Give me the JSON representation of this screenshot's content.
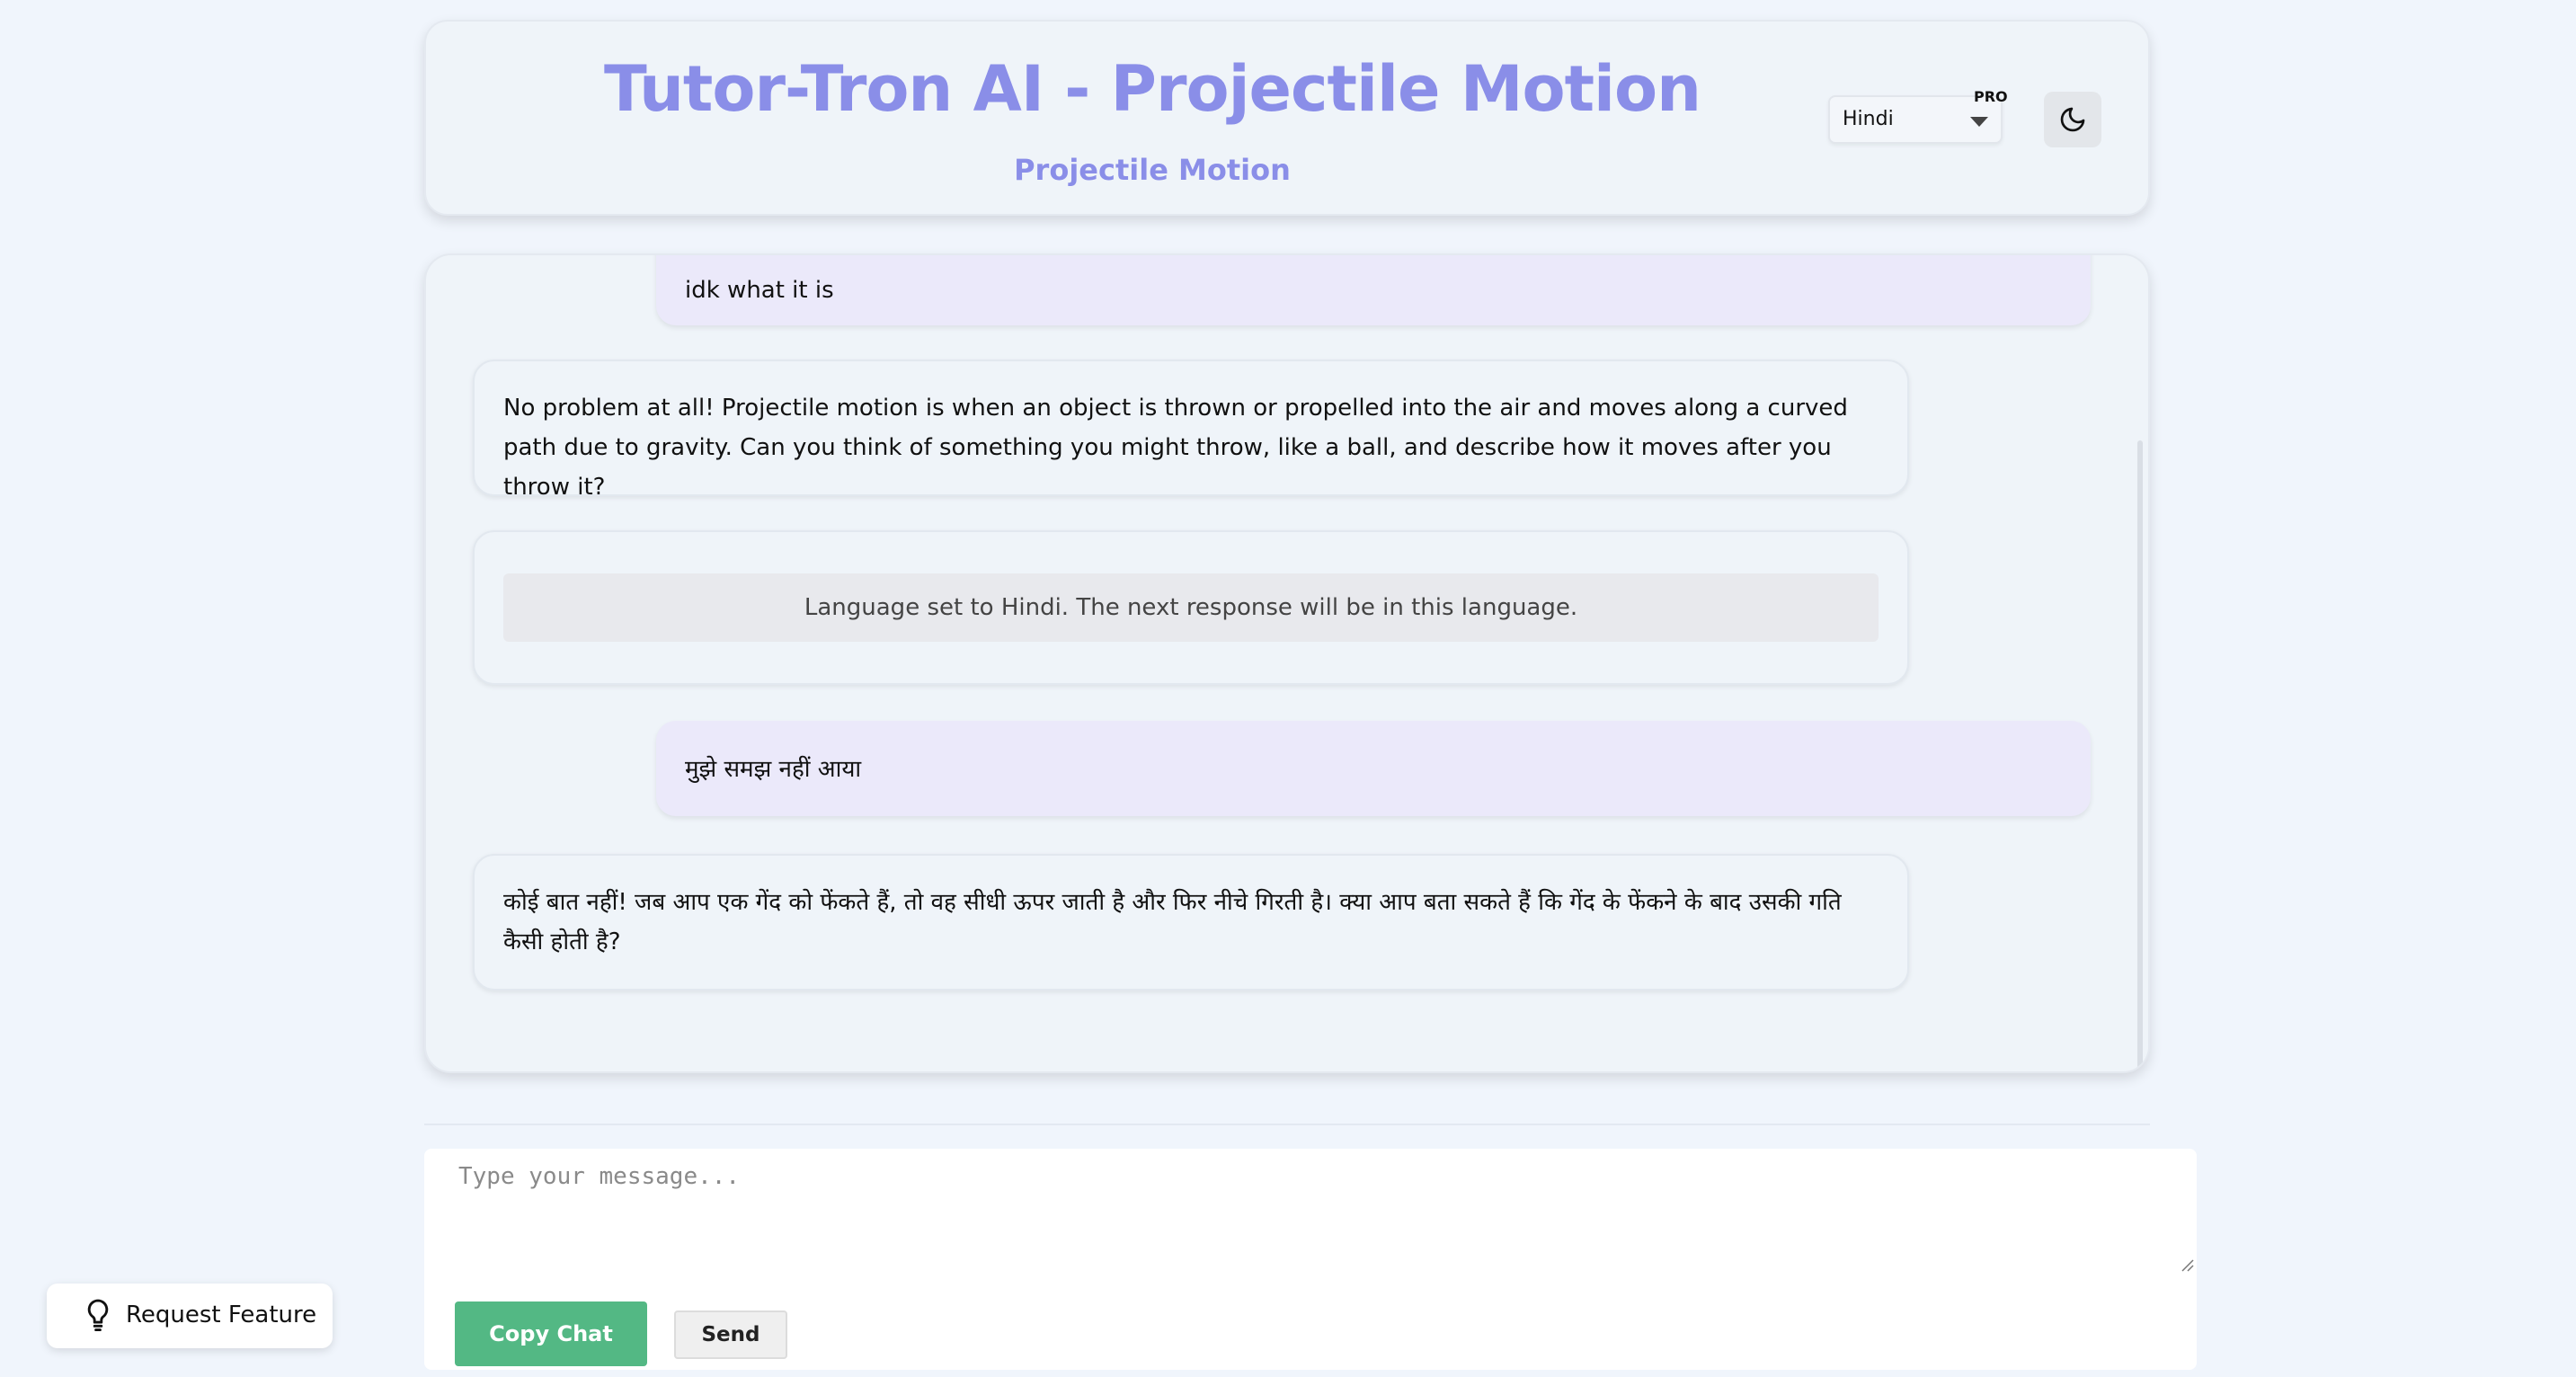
{
  "header": {
    "title": "Tutor-Tron AI - Projectile Motion",
    "subtitle": "Projectile Motion",
    "language_selected": "Hindi",
    "pro_badge": "PRO",
    "theme_toggle_icon": "moon-icon"
  },
  "messages": [
    {
      "role": "user",
      "text": "idk what it is"
    },
    {
      "role": "assistant",
      "text": "No problem at all! Projectile motion is when an object is thrown or propelled into the air and moves along a curved path due to gravity. Can you think of something you might throw, like a ball, and describe how it moves after you throw it?"
    },
    {
      "role": "system",
      "text": "Language set to Hindi. The next response will be in this language."
    },
    {
      "role": "user",
      "text": "मुझे समझ नहीं आया"
    },
    {
      "role": "assistant",
      "text": "कोई बात नहीं! जब आप एक गेंद को फेंकते हैं, तो वह सीधी ऊपर जाती है और फिर नीचे गिरती है। क्या आप बता सकते हैं कि गेंद के फेंकने के बाद उसकी गति कैसी होती है?"
    }
  ],
  "composer": {
    "placeholder": "Type your message...",
    "value": "",
    "copy_label": "Copy Chat",
    "send_label": "Send"
  },
  "request_feature": {
    "label": "Request Feature",
    "icon": "lightbulb-icon"
  },
  "colors": {
    "accent": "#8a8ee8",
    "page_bg": "#f0f5fc",
    "user_bubble": "#ebe9fa",
    "copy_button": "#53b884"
  }
}
